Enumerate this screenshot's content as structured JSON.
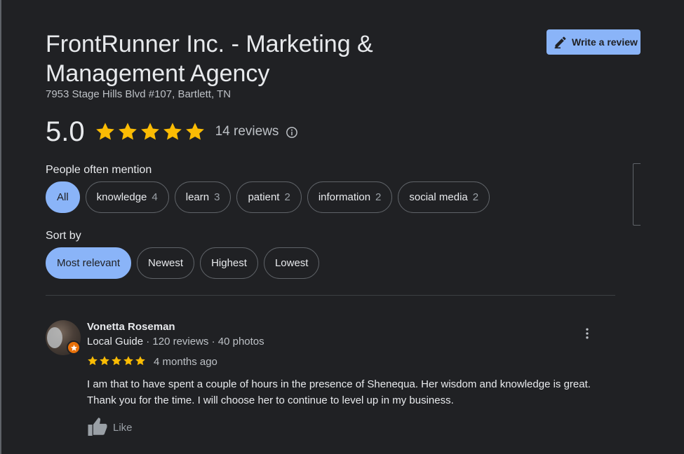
{
  "business": {
    "name": "FrontRunner Inc. - Marketing & Management Agency",
    "address": "7953 Stage Hills Blvd #107, Bartlett, TN",
    "rating": "5.0",
    "stars": 5,
    "review_count_label": "14 reviews"
  },
  "actions": {
    "write_review_label": "Write a review"
  },
  "mentions": {
    "label": "People often mention",
    "chips": [
      {
        "label": "All",
        "count": "",
        "active": true
      },
      {
        "label": "knowledge",
        "count": "4",
        "active": false
      },
      {
        "label": "learn",
        "count": "3",
        "active": false
      },
      {
        "label": "patient",
        "count": "2",
        "active": false
      },
      {
        "label": "information",
        "count": "2",
        "active": false
      },
      {
        "label": "social media",
        "count": "2",
        "active": false
      }
    ]
  },
  "sort": {
    "label": "Sort by",
    "options": [
      {
        "label": "Most relevant",
        "active": true
      },
      {
        "label": "Newest",
        "active": false
      },
      {
        "label": "Highest",
        "active": false
      },
      {
        "label": "Lowest",
        "active": false
      }
    ]
  },
  "review": {
    "reviewer_name": "Vonetta Roseman",
    "badge": "Local Guide",
    "meta": " · 120 reviews · 40 photos",
    "stars": 5,
    "date": "4 months ago",
    "text": "I am that to have spent a couple of hours in the presence of Shenequa.  Her wisdom and knowledge is great.  Thank you for the time. I will choose her to continue to level up in my business.",
    "like_label": "Like"
  },
  "colors": {
    "background": "#202124",
    "accent": "#8ab4f8",
    "star": "#fbbc04",
    "local_guide_badge": "#e8710a"
  },
  "icons": [
    "pencil-icon",
    "star-icon",
    "info-icon",
    "more-vert-icon",
    "thumb-up-icon",
    "local-guide-star-icon"
  ]
}
